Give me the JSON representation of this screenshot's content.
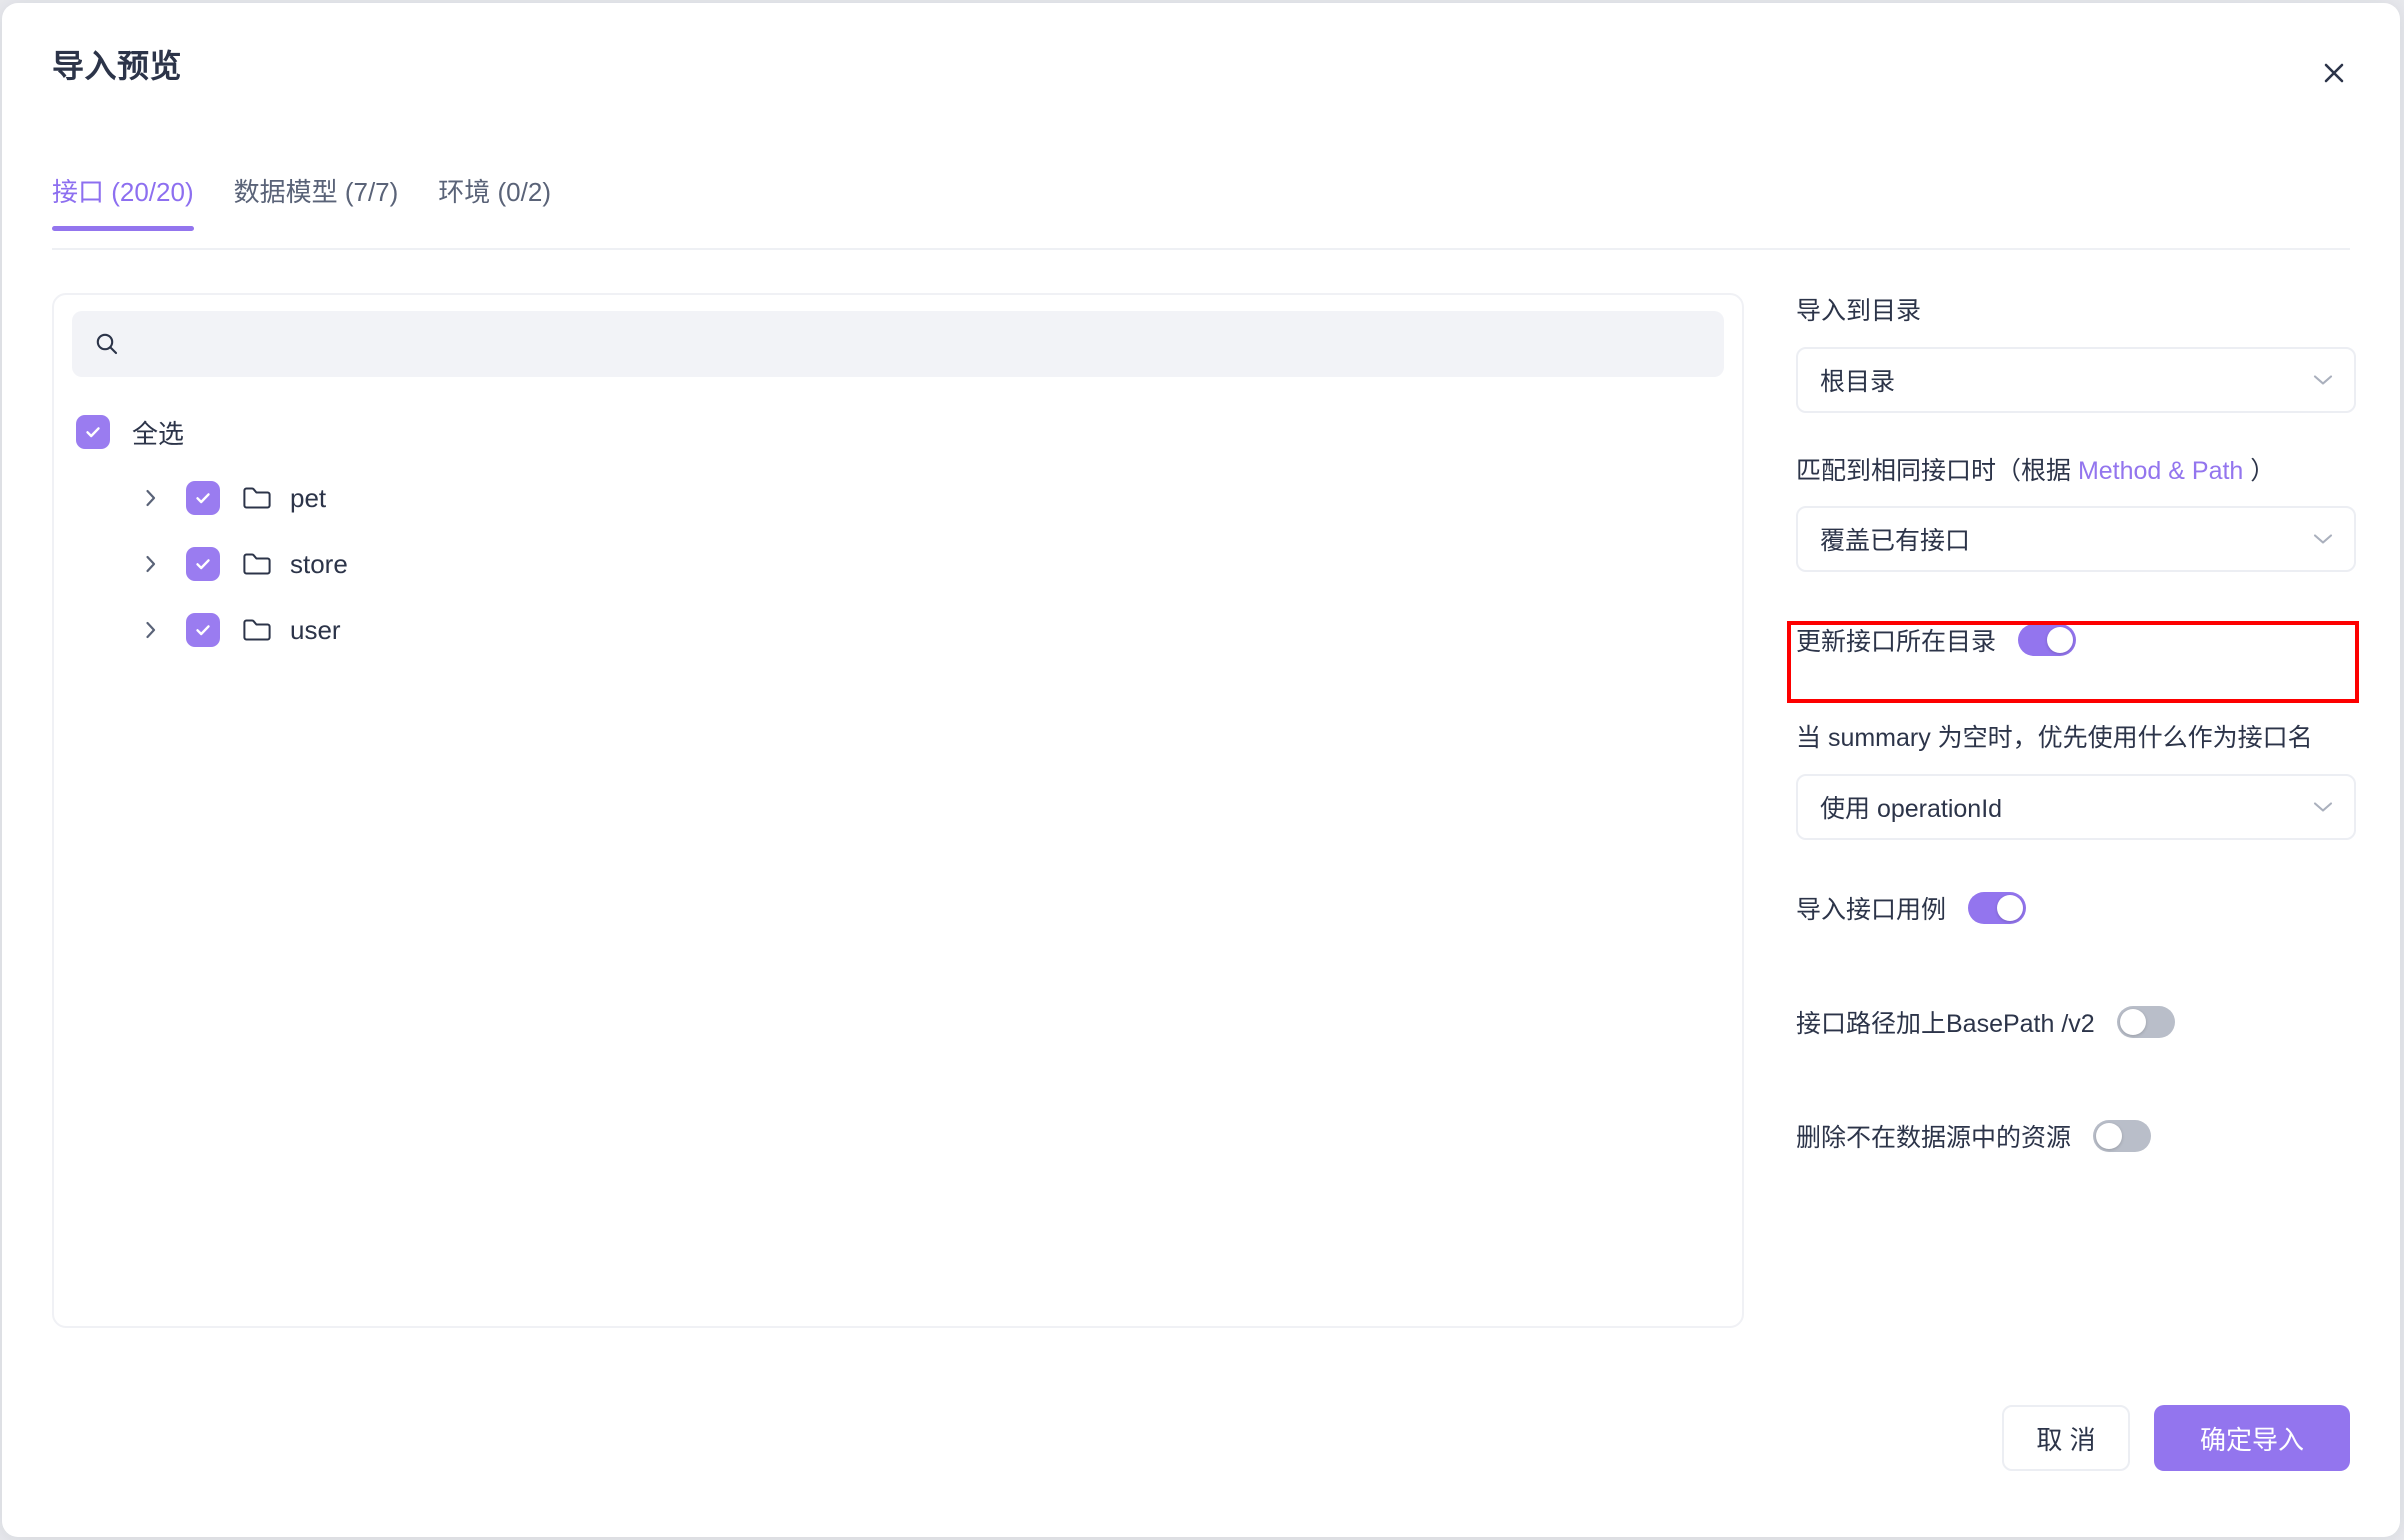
{
  "modal": {
    "title": "导入预览",
    "close_icon": "close-icon"
  },
  "tabs": [
    {
      "label": "接口 (20/20)",
      "active": true
    },
    {
      "label": "数据模型 (7/7)",
      "active": false
    },
    {
      "label": "环境 (0/2)",
      "active": false
    }
  ],
  "left_panel": {
    "search": {
      "icon": "search-icon",
      "value": "",
      "placeholder": ""
    },
    "tree": {
      "select_all": {
        "label": "全选",
        "checked": true
      },
      "nodes": [
        {
          "label": "pet",
          "checked": true,
          "expanded": false,
          "icon": "folder-icon"
        },
        {
          "label": "store",
          "checked": true,
          "expanded": false,
          "icon": "folder-icon"
        },
        {
          "label": "user",
          "checked": true,
          "expanded": false,
          "icon": "folder-icon"
        }
      ]
    }
  },
  "right_panel": {
    "import_dir": {
      "label": "导入到目录",
      "value": "根目录",
      "caret_icon": "chevron-down-icon"
    },
    "match_rule": {
      "label_prefix": "匹配到相同接口时（根据 ",
      "label_accent": "Method & Path",
      "label_suffix": " ）",
      "value": "覆盖已有接口",
      "caret_icon": "chevron-down-icon"
    },
    "update_dir_toggle": {
      "label": "更新接口所在目录",
      "on": true,
      "highlighted": true
    },
    "summary_fallback": {
      "label": "当 summary 为空时，优先使用什么作为接口名",
      "value": "使用 operationId",
      "caret_icon": "chevron-down-icon"
    },
    "import_cases_toggle": {
      "label": "导入接口用例",
      "on": true
    },
    "basepath_toggle": {
      "label": "接口路径加上BasePath /v2",
      "on": false
    },
    "delete_missing_toggle": {
      "label": "删除不在数据源中的资源",
      "on": false
    }
  },
  "footer": {
    "cancel_label": "取 消",
    "confirm_label": "确定导入"
  },
  "colors": {
    "accent": "#9375ee",
    "text": "#2c3449",
    "muted": "#5a6378",
    "annotation": "#fd0000",
    "toggle_off": "#b9bec9",
    "search_bg": "#f2f3f7"
  }
}
